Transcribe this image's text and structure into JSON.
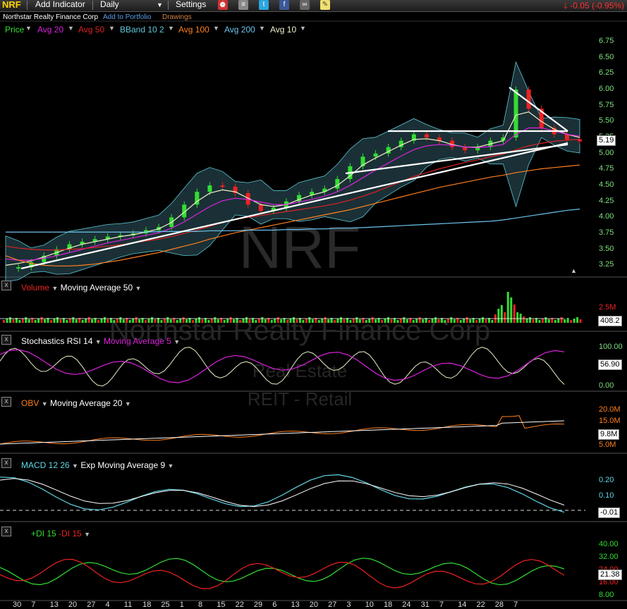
{
  "toolbar": {
    "ticker": "NRF",
    "add_indicator": "Add Indicator",
    "period": "Daily",
    "settings": "Settings",
    "change": "-0.05 (-0.95%)",
    "icons": [
      "alarm-clock-icon",
      "database-icon",
      "twitter-icon",
      "facebook-icon",
      "binoculars-icon",
      "note-icon"
    ]
  },
  "subbar": {
    "company": "Northstar Realty Finance Corp",
    "add_to_portfolio": "Add to Portfolio",
    "drawings": "Drawings"
  },
  "legend": {
    "price": "Price",
    "avg20": "Avg 20",
    "avg50": "Avg 50",
    "bband": "BBand 10 2",
    "avg100": "Avg 100",
    "avg200": "Avg 200",
    "avg10": "Avg 10"
  },
  "watermark": {
    "symbol": "NRF",
    "company": "Northstar Realty Finance Corp",
    "sector": "Real Estate",
    "industry": "REIT - Retail"
  },
  "colors": {
    "up": "#33dd33",
    "down": "#ee2222",
    "avg20": "#dd22dd",
    "avg50": "#dd2222",
    "bband": "#5fc8d8",
    "avg100": "#ff7f1e",
    "avg200": "#6cc4ee",
    "avg10": "#f0f0c8",
    "axis": "#7ee07e"
  },
  "panels": {
    "volume": {
      "title": "Volume",
      "ma": "Moving Average 50",
      "ticks": [
        "2.5M"
      ],
      "value": "408.2"
    },
    "stoch": {
      "title": "Stochastics RSI 14",
      "ma": "Moving Average 5",
      "ticks": [
        "100.00",
        "0.00"
      ],
      "value": "56.90"
    },
    "obv": {
      "title": "OBV",
      "ma": "Moving Average 20",
      "ticks": [
        "20.0M",
        "15.0M",
        "5.0M"
      ],
      "value": "9.8M"
    },
    "macd": {
      "title": "MACD 12 26",
      "ma": "Exp Moving Average 9",
      "ticks": [
        "0.20",
        "0.10"
      ],
      "value": "-0.01"
    },
    "dmi": {
      "title": "+DI 15",
      "title2": "-DI 15",
      "ticks": [
        "40.00",
        "32.00",
        "24.00",
        "16.00",
        "8.00"
      ],
      "value": "21.38"
    }
  },
  "chart_data": {
    "type": "line",
    "title": "NRF",
    "price_ticks": [
      "6.75",
      "6.50",
      "6.25",
      "6.00",
      "5.75",
      "5.50",
      "5.25",
      "5.00",
      "4.75",
      "4.50",
      "4.25",
      "4.00",
      "3.75",
      "3.50",
      "3.25"
    ],
    "ylim": [
      3.1,
      6.85
    ],
    "last_price": "5.19",
    "x_ticks": [
      "30",
      "7",
      "13",
      "20",
      "27",
      "4",
      "11",
      "18",
      "25",
      "1",
      "8",
      "15",
      "22",
      "29",
      "6",
      "13",
      "20",
      "27",
      "3",
      "10",
      "18",
      "24",
      "31",
      "7",
      "14",
      "22",
      "28",
      "7"
    ],
    "series": [
      {
        "name": "Price",
        "values": [
          3.2,
          3.22,
          3.3,
          3.4,
          3.5,
          3.58,
          3.62,
          3.66,
          3.7,
          3.72,
          3.75,
          3.8,
          3.85,
          4.0,
          4.2,
          4.4,
          4.5,
          4.48,
          4.38,
          4.2,
          4.1,
          4.15,
          4.25,
          4.35,
          4.4,
          4.45,
          4.6,
          4.8,
          4.95,
          5.0,
          5.1,
          5.2,
          5.3,
          5.25,
          5.2,
          5.1,
          5.05,
          5.1,
          5.2,
          5.25,
          6.0,
          5.7,
          5.4,
          5.3,
          5.22,
          5.19
        ]
      },
      {
        "name": "Avg 10",
        "values": [
          3.25,
          3.28,
          3.32,
          3.38,
          3.45,
          3.52,
          3.58,
          3.62,
          3.66,
          3.7,
          3.73,
          3.77,
          3.82,
          3.92,
          4.08,
          4.25,
          4.38,
          4.43,
          4.4,
          4.3,
          4.2,
          4.17,
          4.2,
          4.28,
          4.35,
          4.4,
          4.5,
          4.65,
          4.82,
          4.93,
          5.03,
          5.13,
          5.22,
          5.23,
          5.2,
          5.14,
          5.1,
          5.1,
          5.15,
          5.2,
          5.6,
          5.65,
          5.5,
          5.38,
          5.3,
          5.25
        ]
      },
      {
        "name": "Avg 20",
        "values": [
          3.35,
          3.33,
          3.33,
          3.36,
          3.4,
          3.45,
          3.5,
          3.55,
          3.6,
          3.64,
          3.68,
          3.72,
          3.76,
          3.83,
          3.93,
          4.05,
          4.17,
          4.26,
          4.3,
          4.28,
          4.24,
          4.2,
          4.2,
          4.24,
          4.28,
          4.33,
          4.4,
          4.5,
          4.62,
          4.74,
          4.85,
          4.96,
          5.06,
          5.12,
          5.14,
          5.13,
          5.1,
          5.09,
          5.11,
          5.14,
          5.3,
          5.4,
          5.4,
          5.35,
          5.3,
          5.27
        ]
      },
      {
        "name": "Avg 50",
        "values": [
          3.55,
          3.52,
          3.5,
          3.49,
          3.49,
          3.5,
          3.51,
          3.53,
          3.55,
          3.57,
          3.6,
          3.63,
          3.66,
          3.7,
          3.75,
          3.8,
          3.86,
          3.92,
          3.97,
          4.0,
          4.03,
          4.06,
          4.09,
          4.12,
          4.15,
          4.18,
          4.22,
          4.27,
          4.33,
          4.4,
          4.48,
          4.56,
          4.64,
          4.7,
          4.76,
          4.81,
          4.86,
          4.9,
          4.95,
          4.99,
          5.06,
          5.12,
          5.16,
          5.19,
          5.21,
          5.22
        ]
      },
      {
        "name": "Avg 100",
        "values": [
          3.4,
          3.33,
          3.28,
          3.25,
          3.24,
          3.24,
          3.25,
          3.27,
          3.3,
          3.33,
          3.37,
          3.41,
          3.45,
          3.5,
          3.55,
          3.6,
          3.66,
          3.71,
          3.76,
          3.8,
          3.84,
          3.88,
          3.92,
          3.96,
          4.0,
          4.04,
          4.08,
          4.12,
          4.17,
          4.22,
          4.27,
          4.32,
          4.37,
          4.42,
          4.47,
          4.51,
          4.55,
          4.59,
          4.63,
          4.66,
          4.7,
          4.73,
          4.76,
          4.78,
          4.8,
          4.82
        ]
      },
      {
        "name": "Avg 200",
        "values": [
          3.77,
          3.77,
          3.77,
          3.77,
          3.77,
          3.77,
          3.77,
          3.77,
          3.77,
          3.77,
          3.77,
          3.77,
          3.78,
          3.78,
          3.78,
          3.78,
          3.79,
          3.79,
          3.79,
          3.8,
          3.8,
          3.8,
          3.81,
          3.81,
          3.82,
          3.82,
          3.83,
          3.83,
          3.84,
          3.85,
          3.86,
          3.87,
          3.88,
          3.89,
          3.9,
          3.91,
          3.92,
          3.93,
          3.94,
          3.96,
          3.99,
          4.02,
          4.05,
          4.08,
          4.11,
          4.13
        ]
      }
    ]
  }
}
